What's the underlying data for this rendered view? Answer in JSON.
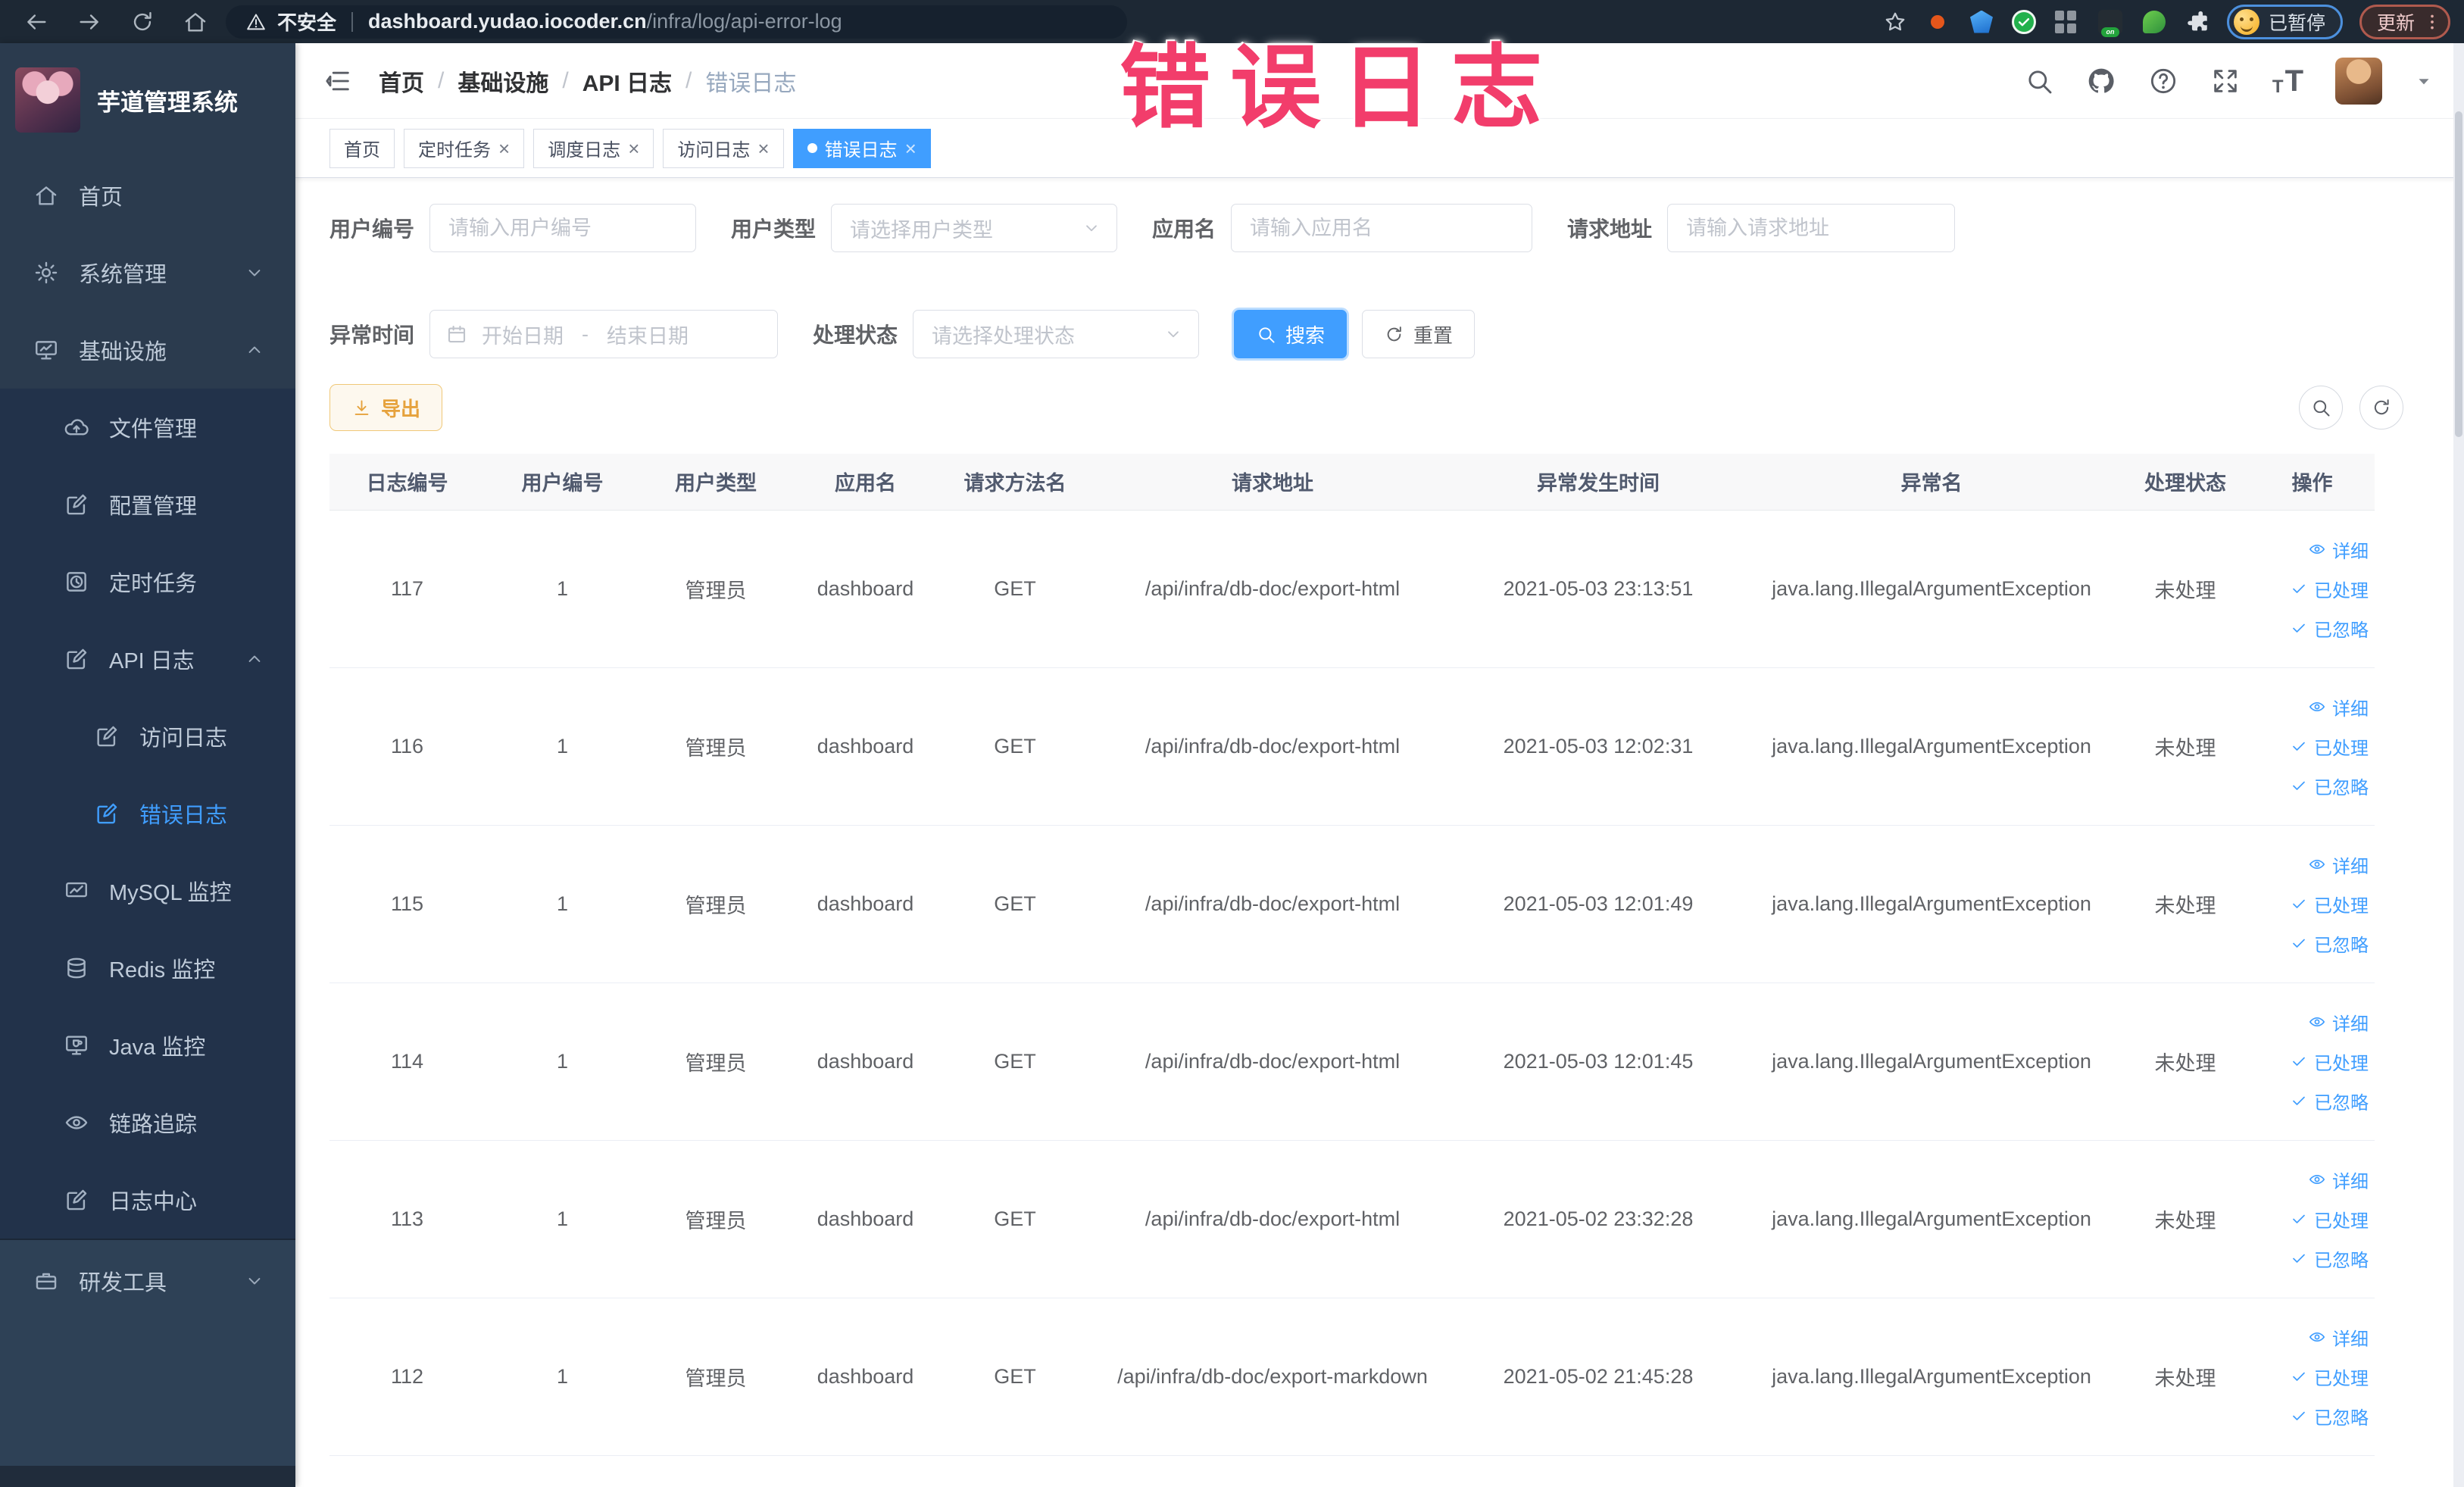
{
  "overlay": {
    "stamp": "错误日志"
  },
  "browser": {
    "security_label": "不安全",
    "url_host": "dashboard.yudao.iocoder.cn",
    "url_path": "/infra/log/api-error-log",
    "profile_badge": "已暂停",
    "update_label": "更新"
  },
  "sidebar": {
    "title": "芋道管理系统",
    "items": [
      {
        "key": "home",
        "label": "首页",
        "icon": "home-icon",
        "level": 1
      },
      {
        "key": "system",
        "label": "系统管理",
        "icon": "gear-icon",
        "level": 1,
        "chevron": "down"
      },
      {
        "key": "infra",
        "label": "基础设施",
        "icon": "infra-icon",
        "level": 1,
        "chevron": "up"
      },
      {
        "key": "file",
        "label": "文件管理",
        "icon": "file-icon",
        "level": 2
      },
      {
        "key": "config",
        "label": "配置管理",
        "icon": "config-icon",
        "level": 2
      },
      {
        "key": "job",
        "label": "定时任务",
        "icon": "job-icon",
        "level": 2
      },
      {
        "key": "api-log",
        "label": "API 日志",
        "icon": "api-log-icon",
        "level": 2,
        "chevron": "up"
      },
      {
        "key": "access-log",
        "label": "访问日志",
        "icon": "access-log-icon",
        "level": 3
      },
      {
        "key": "error-log",
        "label": "错误日志",
        "icon": "error-log-icon",
        "level": 3,
        "active": true
      },
      {
        "key": "mysql",
        "label": "MySQL 监控",
        "icon": "mysql-icon",
        "level": 2
      },
      {
        "key": "redis",
        "label": "Redis 监控",
        "icon": "redis-icon",
        "level": 2
      },
      {
        "key": "java",
        "label": "Java 监控",
        "icon": "java-icon",
        "level": 2
      },
      {
        "key": "trace",
        "label": "链路追踪",
        "icon": "trace-icon",
        "level": 2
      },
      {
        "key": "log-center",
        "label": "日志中心",
        "icon": "log-center-icon",
        "level": 2
      },
      {
        "key": "devtools",
        "label": "研发工具",
        "icon": "devtools-icon",
        "level": 1,
        "chevron": "down",
        "section": "bottom"
      }
    ]
  },
  "header": {
    "breadcrumb": [
      "首页",
      "基础设施",
      "API 日志",
      "错误日志"
    ]
  },
  "tabs": [
    {
      "key": "home",
      "label": "首页"
    },
    {
      "key": "job",
      "label": "定时任务",
      "closable": true
    },
    {
      "key": "job-log",
      "label": "调度日志",
      "closable": true
    },
    {
      "key": "access-log",
      "label": "访问日志",
      "closable": true
    },
    {
      "key": "error-log",
      "label": "错误日志",
      "closable": true,
      "active": true
    }
  ],
  "filters": {
    "user_id": {
      "label": "用户编号",
      "placeholder": "请输入用户编号"
    },
    "user_type": {
      "label": "用户类型",
      "placeholder": "请选择用户类型"
    },
    "app_name": {
      "label": "应用名",
      "placeholder": "请输入应用名"
    },
    "request_url": {
      "label": "请求地址",
      "placeholder": "请输入请求地址"
    },
    "exception_time": {
      "label": "异常时间",
      "start_placeholder": "开始日期",
      "separator": "-",
      "end_placeholder": "结束日期"
    },
    "process_status": {
      "label": "处理状态",
      "placeholder": "请选择处理状态"
    },
    "search_label": "搜索",
    "reset_label": "重置"
  },
  "toolbar": {
    "export_label": "导出"
  },
  "table": {
    "columns": [
      "日志编号",
      "用户编号",
      "用户类型",
      "应用名",
      "请求方法名",
      "请求地址",
      "异常发生时间",
      "异常名",
      "处理状态",
      "操作"
    ],
    "action_labels": [
      "详细",
      "已处理",
      "已忽略"
    ],
    "rows": [
      [
        "117",
        "1",
        "管理员",
        "dashboard",
        "GET",
        "/api/infra/db-doc/export-html",
        "2021-05-03 23:13:51",
        "java.lang.IllegalArgumentException",
        "未处理"
      ],
      [
        "116",
        "1",
        "管理员",
        "dashboard",
        "GET",
        "/api/infra/db-doc/export-html",
        "2021-05-03 12:02:31",
        "java.lang.IllegalArgumentException",
        "未处理"
      ],
      [
        "115",
        "1",
        "管理员",
        "dashboard",
        "GET",
        "/api/infra/db-doc/export-html",
        "2021-05-03 12:01:49",
        "java.lang.IllegalArgumentException",
        "未处理"
      ],
      [
        "114",
        "1",
        "管理员",
        "dashboard",
        "GET",
        "/api/infra/db-doc/export-html",
        "2021-05-03 12:01:45",
        "java.lang.IllegalArgumentException",
        "未处理"
      ],
      [
        "113",
        "1",
        "管理员",
        "dashboard",
        "GET",
        "/api/infra/db-doc/export-html",
        "2021-05-02 23:32:28",
        "java.lang.IllegalArgumentException",
        "未处理"
      ],
      [
        "112",
        "1",
        "管理员",
        "dashboard",
        "GET",
        "/api/infra/db-doc/export-markdown",
        "2021-05-02 21:45:28",
        "java.lang.IllegalArgumentException",
        "未处理"
      ]
    ]
  },
  "colors": {
    "accent": "#409eff",
    "warning": "#e6a23c",
    "stamp": "#f23d6b",
    "sidebar_bg": "#2b3b4e"
  }
}
